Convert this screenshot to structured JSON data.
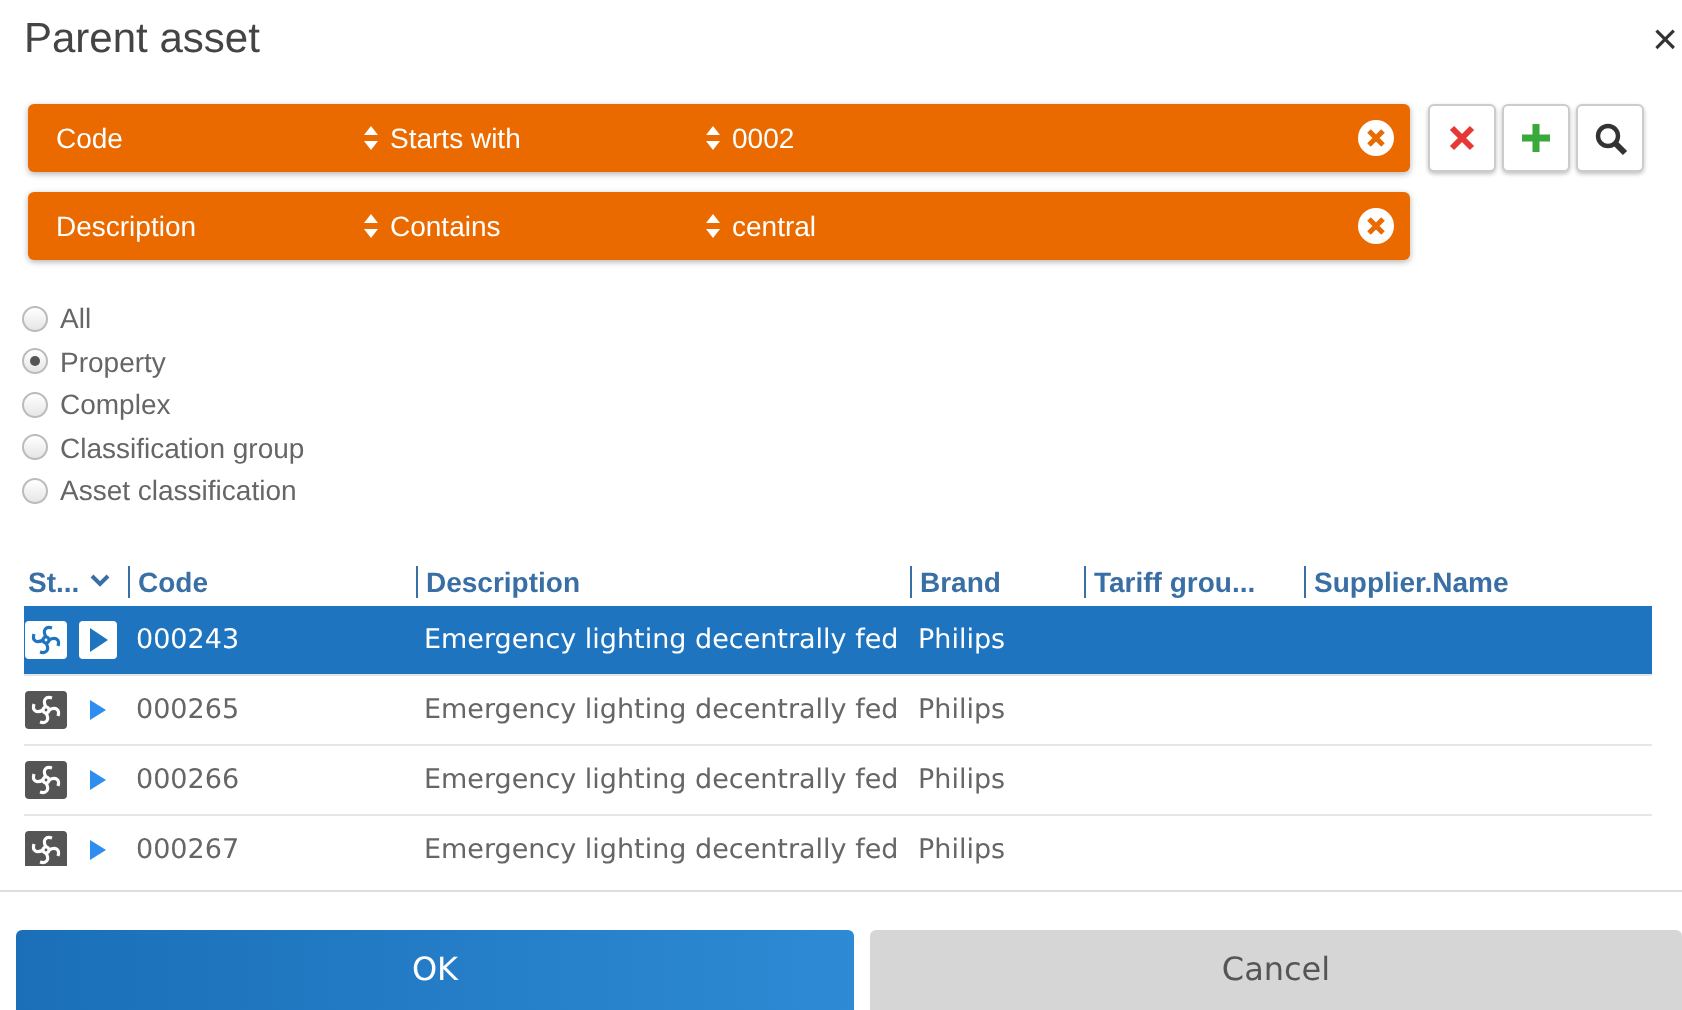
{
  "window": {
    "title": "Parent asset",
    "close": "×"
  },
  "filters": [
    {
      "field": "Code",
      "operator": "Starts with",
      "value": "0002"
    },
    {
      "field": "Description",
      "operator": "Contains",
      "value": "central"
    }
  ],
  "radios": [
    {
      "label": "All",
      "selected": false
    },
    {
      "label": "Property",
      "selected": true
    },
    {
      "label": "Complex",
      "selected": false
    },
    {
      "label": "Classification group",
      "selected": false
    },
    {
      "label": "Asset classification",
      "selected": false
    }
  ],
  "table": {
    "columns": [
      "St...",
      "Code",
      "Description",
      "Brand",
      "Tariff grou...",
      "Supplier.Name"
    ],
    "rows": [
      {
        "code": "000243",
        "description": "Emergency lighting decentrally fed",
        "brand": "Philips",
        "selected": true
      },
      {
        "code": "000265",
        "description": "Emergency lighting decentrally fed",
        "brand": "Philips",
        "selected": false
      },
      {
        "code": "000266",
        "description": "Emergency lighting decentrally fed",
        "brand": "Philips",
        "selected": false
      },
      {
        "code": "000267",
        "description": "Emergency lighting decentrally fed",
        "brand": "Philips",
        "selected": false
      }
    ]
  },
  "buttons": [
    {
      "label": "OK",
      "kind": "primary"
    },
    {
      "label": "Cancel",
      "kind": "secondary"
    }
  ]
}
